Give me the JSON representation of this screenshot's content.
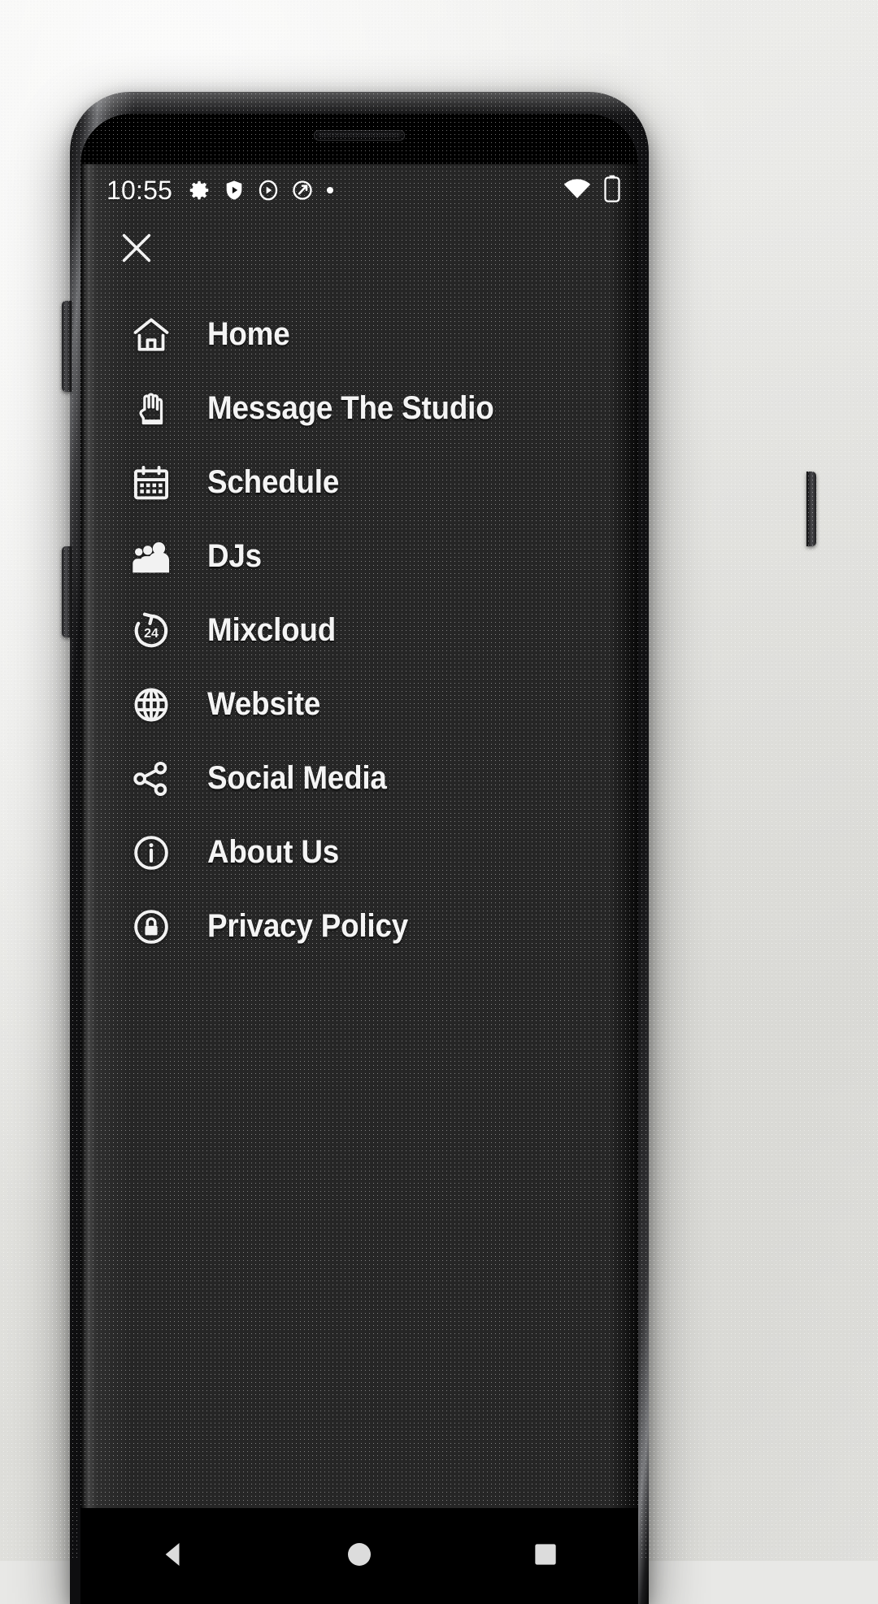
{
  "statusbar": {
    "time": "10:55",
    "left_icons": [
      "gear-icon",
      "shield-play-icon",
      "play-circle-icon",
      "do-not-disturb-icon",
      "dot-icon"
    ],
    "right_icons": [
      "wifi-icon",
      "battery-icon"
    ]
  },
  "drawer": {
    "close_label": "Close",
    "items": [
      {
        "label": "Home",
        "icon": "home-icon"
      },
      {
        "label": "Message The Studio",
        "icon": "hand-icon"
      },
      {
        "label": "Schedule",
        "icon": "calendar-icon"
      },
      {
        "label": "DJs",
        "icon": "people-group-icon"
      },
      {
        "label": "Mixcloud",
        "icon": "rotate-24-icon"
      },
      {
        "label": "Website",
        "icon": "globe-icon"
      },
      {
        "label": "Social Media",
        "icon": "share-icon"
      },
      {
        "label": "About Us",
        "icon": "info-circle-icon"
      },
      {
        "label": "Privacy Policy",
        "icon": "lock-circle-icon"
      }
    ]
  },
  "navbar": {
    "back_label": "Back",
    "home_label": "Home",
    "recents_label": "Recents"
  },
  "colors": {
    "drawer_bg": "#262626",
    "text": "#f4f4f4",
    "navbar_bg": "#000000"
  }
}
